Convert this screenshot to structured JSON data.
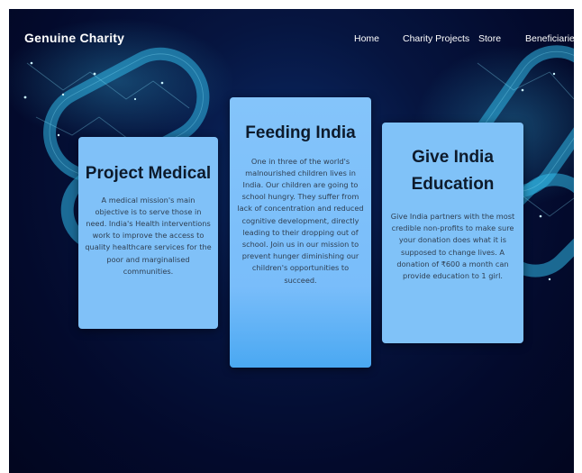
{
  "header": {
    "brand": "Genuine Charity",
    "nav": [
      "Home",
      "Charity Projects",
      "Store",
      "Beneficiaries"
    ]
  },
  "cards": [
    {
      "title": "Project Medical",
      "body": "A medical mission's main objective is to serve those in need. India's Health interventions work to improve the access to quality healthcare services for the poor and marginalised communities."
    },
    {
      "title": "Feeding India",
      "body": "One in three of the world's malnourished children lives in India. Our children are going to school hungry. They suffer from lack of concentration and reduced cognitive development, directly leading to their dropping out of school. Join us in our mission to prevent hunger diminishing our children's opportunities to succeed."
    },
    {
      "title": "Give India Education",
      "body": "Give India partners with the most credible non-profits to make sure your donation does what it is supposed to change lives. A donation of ₹600 a month can provide education to 1 girl."
    }
  ],
  "colors": {
    "background": "#030a2c",
    "card": "#80c1f8",
    "chain_glow": "#2fb8e8"
  },
  "background_image": "glowing-chain-network"
}
